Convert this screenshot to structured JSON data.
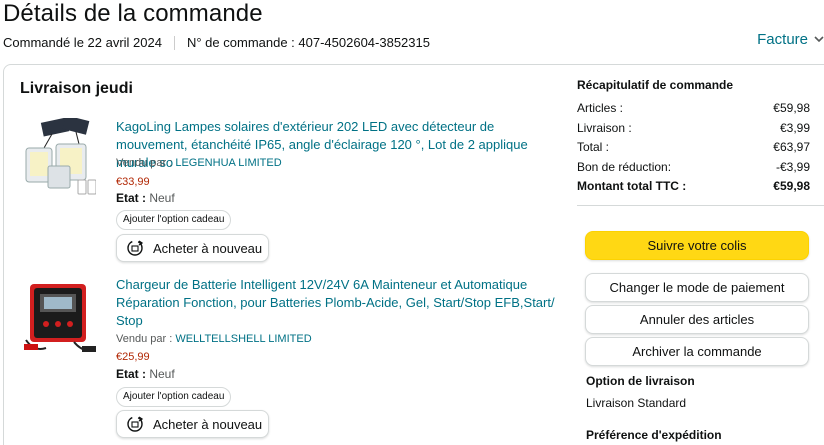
{
  "header": {
    "title": "Détails de la commande",
    "ordered_on": "Commandé le 22 avril 2024",
    "order_number": "N° de commande : 407-4502604-3852315",
    "invoice_label": "Facture",
    "invoice_chevron": "chevron-down-icon"
  },
  "shipment": {
    "heading": "Livraison jeudi",
    "items": [
      {
        "title": "KagoLing Lampes solaires d'extérieur 202 LED avec détecteur de mouvement, étanchéité IP65, angle d'éclairage 120 °, Lot de 2 applique murale so",
        "seller_prefix": "Vendu par : ",
        "seller": "LEGENHUA LIMITED",
        "price": "€33,99",
        "condition_label": "Etat : ",
        "condition": "Neuf",
        "gift_label": "Ajouter l'option cadeau",
        "rebuy_label": "Acheter à nouveau"
      },
      {
        "title": "Chargeur de Batterie Intelligent 12V/24V 6A Mainteneur et Automatique Réparation Fonction, pour Batteries Plomb-Acide, Gel, Start/Stop EFB,Start/ Stop",
        "seller_prefix": "Vendu par : ",
        "seller": "WELLTELLSHELL LIMITED",
        "price": "€25,99",
        "condition_label": "Etat : ",
        "condition": "Neuf",
        "gift_label": "Ajouter l'option cadeau",
        "rebuy_label": "Acheter à nouveau"
      }
    ]
  },
  "summary": {
    "heading": "Récapitulatif de commande",
    "rows": [
      {
        "label": "Articles :",
        "value": "€59,98"
      },
      {
        "label": "Livraison :",
        "value": "€3,99"
      },
      {
        "label": "Total :",
        "value": "€63,97"
      },
      {
        "label": "Bon de réduction:",
        "value": "-€3,99"
      }
    ],
    "grand_total_label": "Montant total TTC :",
    "grand_total_value": "€59,98"
  },
  "actions": {
    "track": "Suivre votre colis",
    "change_payment": "Changer le mode de paiement",
    "cancel": "Annuler des articles",
    "archive": "Archiver la commande"
  },
  "delivery_option": {
    "heading": "Option de livraison",
    "value": "Livraison Standard"
  },
  "shipping_pref": {
    "heading": "Préférence d'expédition"
  },
  "colors": {
    "link": "#007185",
    "price": "#b12704",
    "primary_button": "#ffd814"
  }
}
